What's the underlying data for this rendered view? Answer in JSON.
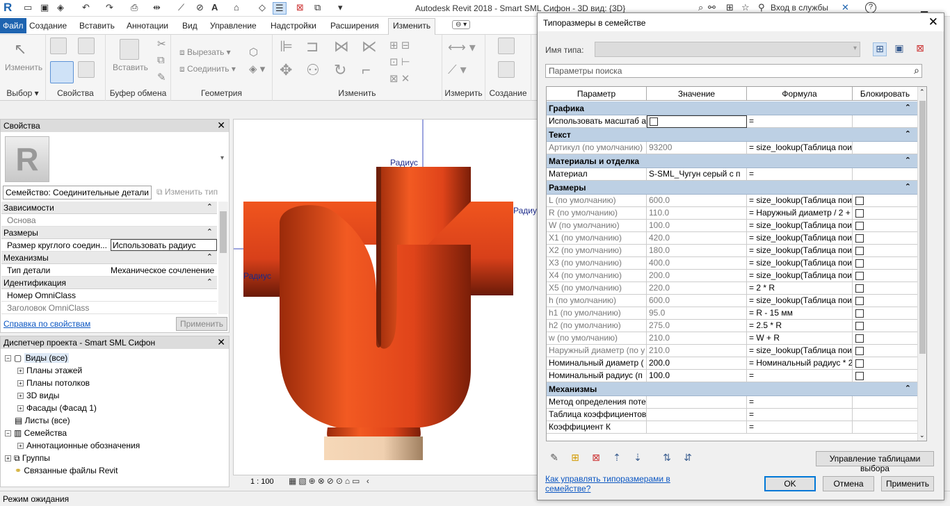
{
  "window": {
    "title": "Autodesk Revit 2018 -   Smart SML Сифон - 3D вид: {3D}",
    "signin": "Вход в службы",
    "help": "?"
  },
  "menu": {
    "tabs": [
      "Файл",
      "Создание",
      "Вставить",
      "Аннотации",
      "Вид",
      "Управление",
      "Надстройки",
      "Расширения",
      "Изменить"
    ]
  },
  "ribbon": {
    "modify": "Изменить",
    "select": "Выбор",
    "properties": "Свойства",
    "paste": "Вставить",
    "clipboard": "Буфер обмена",
    "cut": "Вырезать",
    "join": "Соединить",
    "geometry": "Геометрия",
    "modify_group": "Изменить",
    "measure": "Измерить",
    "create": "Создание"
  },
  "properties": {
    "title": "Свойства",
    "close": "✕",
    "family_selector": "Семейство: Соединительные детали",
    "edit_type": "Изменить тип",
    "sections": [
      {
        "label": "Зависимости",
        "rows": [
          {
            "k": "Основа",
            "v": ""
          }
        ]
      },
      {
        "label": "Размеры",
        "rows": [
          {
            "k": "Размер круглого соедин...",
            "v": "Использовать радиус"
          }
        ]
      },
      {
        "label": "Механизмы",
        "rows": [
          {
            "k": "Тип детали",
            "v": "Механическое сочленение"
          }
        ]
      },
      {
        "label": "Идентификация",
        "rows": [
          {
            "k": "Номер OmniClass",
            "v": ""
          },
          {
            "k": "Заголовок OmniClass",
            "v": ""
          }
        ]
      }
    ],
    "help_link": "Справка по свойствам",
    "apply": "Применить"
  },
  "browser": {
    "title": "Диспетчер проекта - Smart SML Сифон",
    "close": "✕",
    "items": [
      {
        "label": "Виды (все)",
        "level": 0,
        "sign": "−"
      },
      {
        "label": "Планы этажей",
        "level": 1,
        "sign": "+"
      },
      {
        "label": "Планы потолков",
        "level": 1,
        "sign": "+"
      },
      {
        "label": "3D виды",
        "level": 1,
        "sign": "+"
      },
      {
        "label": "Фасады (Фасад 1)",
        "level": 1,
        "sign": "+"
      },
      {
        "label": "Листы (все)",
        "level": 0,
        "sign": ""
      },
      {
        "label": "Семейства",
        "level": 0,
        "sign": "−"
      },
      {
        "label": "Аннотационные обозначения",
        "level": 1,
        "sign": "+"
      },
      {
        "label": "Группы",
        "level": 0,
        "sign": "+"
      },
      {
        "label": "Связанные файлы Revit",
        "level": 0,
        "sign": ""
      }
    ]
  },
  "viewport": {
    "labels": [
      "Радиус",
      "Радиус",
      "Радиус"
    ],
    "scale": "1 : 100"
  },
  "status": {
    "text": "Режим ожидания"
  },
  "dialog": {
    "title": "Типоразмеры в семействе",
    "close": "✕",
    "type_name_label": "Имя типа:",
    "type_name_value": "",
    "search_placeholder": "Параметры поиска",
    "columns": [
      "Параметр",
      "Значение",
      "Формула",
      "Блокировать"
    ],
    "groups": [
      {
        "label": "Графика",
        "rows": [
          {
            "p": "Использовать масштаб а",
            "v": "",
            "f": "=",
            "lock": false,
            "gray": false,
            "check_value": true,
            "lockbox": false
          }
        ]
      },
      {
        "label": "Текст",
        "rows": [
          {
            "p": "Артикул (по умолчанию)",
            "v": "93200",
            "f": "= size_lookup(Таблица пои",
            "gray": true,
            "lockbox": false
          }
        ]
      },
      {
        "label": "Материалы и отделка",
        "rows": [
          {
            "p": "Материал",
            "v": "S-SML_Чугун серый с п",
            "f": "=",
            "gray": false,
            "lockbox": false
          }
        ]
      },
      {
        "label": "Размеры",
        "rows": [
          {
            "p": "L (по умолчанию)",
            "v": "600.0",
            "f": "= size_lookup(Таблица пои",
            "gray": true,
            "lockbox": true
          },
          {
            "p": "R (по умолчанию)",
            "v": "110.0",
            "f": "= Наружный диаметр / 2 +",
            "gray": true,
            "lockbox": true
          },
          {
            "p": "W (по умолчанию)",
            "v": "100.0",
            "f": "= size_lookup(Таблица пои",
            "gray": true,
            "lockbox": true
          },
          {
            "p": "X1 (по умолчанию)",
            "v": "420.0",
            "f": "= size_lookup(Таблица пои",
            "gray": true,
            "lockbox": true
          },
          {
            "p": "X2 (по умолчанию)",
            "v": "180.0",
            "f": "= size_lookup(Таблица пои",
            "gray": true,
            "lockbox": true
          },
          {
            "p": "X3 (по умолчанию)",
            "v": "400.0",
            "f": "= size_lookup(Таблица пои",
            "gray": true,
            "lockbox": true
          },
          {
            "p": "X4 (по умолчанию)",
            "v": "200.0",
            "f": "= size_lookup(Таблица пои",
            "gray": true,
            "lockbox": true
          },
          {
            "p": "X5 (по умолчанию)",
            "v": "220.0",
            "f": "= 2 * R",
            "gray": true,
            "lockbox": true
          },
          {
            "p": "h (по умолчанию)",
            "v": "600.0",
            "f": "= size_lookup(Таблица пои",
            "gray": true,
            "lockbox": true
          },
          {
            "p": "h1 (по умолчанию)",
            "v": "95.0",
            "f": "= R - 15 мм",
            "gray": true,
            "lockbox": true
          },
          {
            "p": "h2 (по умолчанию)",
            "v": "275.0",
            "f": "= 2.5 * R",
            "gray": true,
            "lockbox": true
          },
          {
            "p": "w (по умолчанию)",
            "v": "210.0",
            "f": "= W + R",
            "gray": true,
            "lockbox": true
          },
          {
            "p": "Наружный диаметр (по у",
            "v": "210.0",
            "f": "= size_lookup(Таблица пои",
            "gray": true,
            "lockbox": true
          },
          {
            "p": "Номинальный диаметр (",
            "v": "200.0",
            "f": "= Номинальный радиус * 2",
            "gray": false,
            "lockbox": true
          },
          {
            "p": "Номинальный радиус (п",
            "v": "100.0",
            "f": "=",
            "gray": false,
            "lockbox": true
          }
        ]
      },
      {
        "label": "Механизмы",
        "rows": [
          {
            "p": "Метод определения поте",
            "v": "",
            "f": "=",
            "gray": false,
            "lockbox": false
          },
          {
            "p": "Таблица коэффициентов",
            "v": "",
            "f": "=",
            "gray": false,
            "lockbox": false
          },
          {
            "p": "Коэффициент К",
            "v": "",
            "f": "=",
            "gray": false,
            "lockbox": false
          }
        ]
      }
    ],
    "manage_tables": "Управление таблицами выбора",
    "help_link": "Как управлять типоразмерами в семействе?",
    "ok": "OK",
    "cancel": "Отмена",
    "apply": "Применить"
  },
  "colors": {
    "pipe": "#e8461a",
    "pipe_dark": "#6a1a08",
    "category_bg": "#bdd0e4",
    "file_tab": "#1e64b0"
  }
}
